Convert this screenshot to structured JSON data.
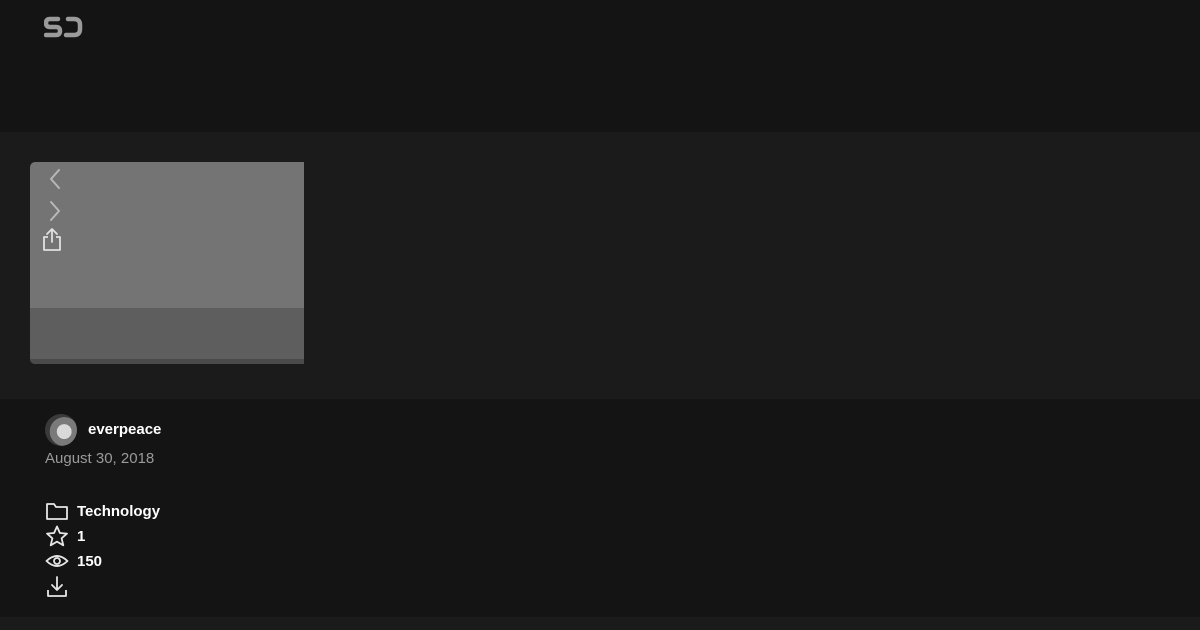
{
  "logo": {
    "icon": "sd-logo-icon",
    "color": "#9a9a9a"
  },
  "viewer": {
    "controls": {
      "prev_icon": "chevron-left-icon",
      "next_icon": "chevron-right-icon",
      "share_icon": "share-icon"
    }
  },
  "author": {
    "name": "everpeace",
    "avatar_icon": "avatar"
  },
  "date": "August 30, 2018",
  "stats": {
    "category": {
      "icon": "folder-icon",
      "label": "Technology"
    },
    "likes": {
      "icon": "star-icon",
      "value": "1"
    },
    "views": {
      "icon": "eye-icon",
      "value": "150"
    },
    "download": {
      "icon": "download-icon"
    }
  },
  "colors": {
    "background": "#141414",
    "panel": "#1b1b1b",
    "slide": "#747474",
    "text": "#ffffff",
    "muted": "#9a9a9a"
  }
}
